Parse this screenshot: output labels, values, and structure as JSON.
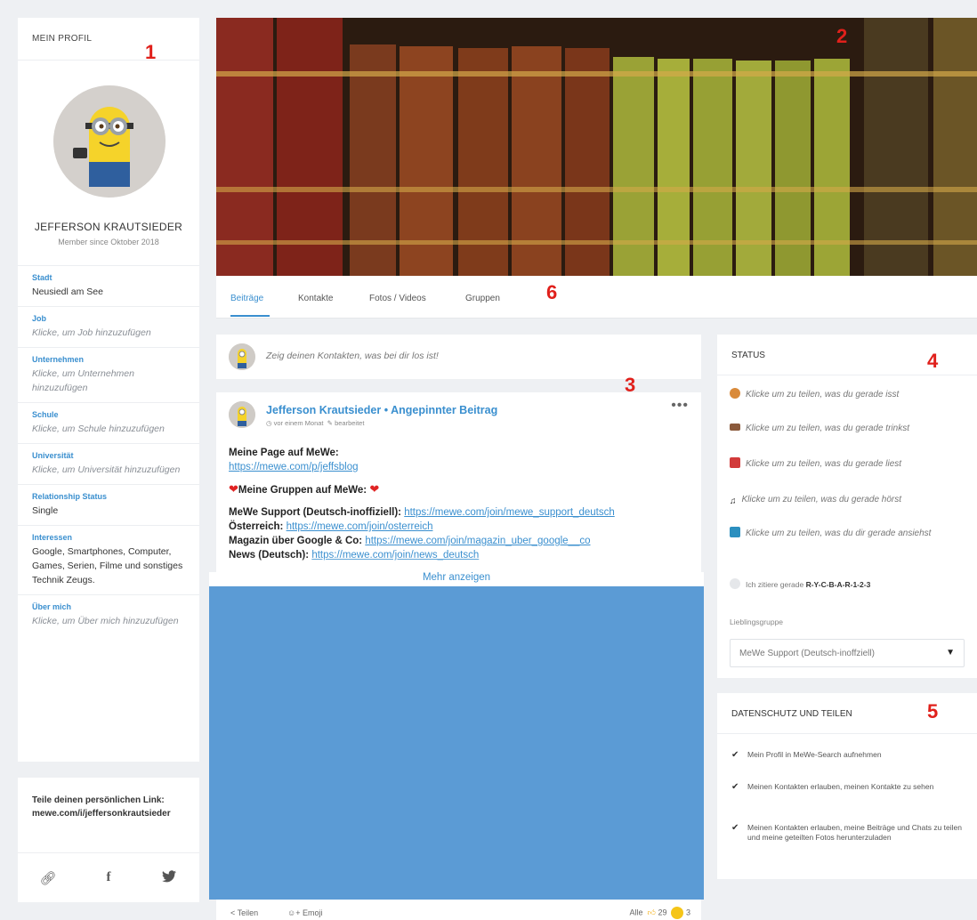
{
  "profile": {
    "header": "MEIN PROFIL",
    "name": "JEFFERSON KRAUTSIEDER",
    "member_since": "Member since Oktober 2018",
    "fields": [
      {
        "label": "Stadt",
        "value": "Neusiedl am See",
        "placeholder": false
      },
      {
        "label": "Job",
        "value": "Klicke, um Job hinzuzufügen",
        "placeholder": true
      },
      {
        "label": "Unternehmen",
        "value": "Klicke, um Unternehmen hinzuzufügen",
        "placeholder": true
      },
      {
        "label": "Schule",
        "value": "Klicke, um Schule hinzuzufügen",
        "placeholder": true
      },
      {
        "label": "Universität",
        "value": "Klicke, um Universität hinzuzufügen",
        "placeholder": true
      },
      {
        "label": "Relationship Status",
        "value": "Single",
        "placeholder": false
      },
      {
        "label": "Interessen",
        "value": "Google, Smartphones, Computer, Games, Serien, Filme und sonstiges Technik Zeugs.",
        "placeholder": false
      },
      {
        "label": "Über mich",
        "value": "Klicke, um Über mich hinzuzufügen",
        "placeholder": true
      }
    ]
  },
  "link_card": {
    "label": "Teile deinen persönlichen Link:",
    "url": "mewe.com/i/jeffersonkrautsieder",
    "icons": [
      "link-icon",
      "facebook-icon",
      "twitter-icon"
    ]
  },
  "tabs": [
    "Beiträge",
    "Kontakte",
    "Fotos / Videos",
    "Gruppen"
  ],
  "composer": {
    "placeholder": "Zeig deinen Kontakten, was bei dir los ist!"
  },
  "post": {
    "author": "Jefferson Krautsieder",
    "pinned": "Angepinnter Beitrag",
    "time": "vor einem Monat",
    "edited": "bearbeitet",
    "line1": "Meine Page auf MeWe:",
    "link1": "https://mewe.com/p/jeffsblog",
    "groups_title": "Meine Gruppen auf MeWe:",
    "g1_label": "MeWe Support (Deutsch-inoffiziell):",
    "g1_link": "https://mewe.com/join/mewe_support_deutsch",
    "g2_label": "Österreich:",
    "g2_link": "https://mewe.com/join/osterreich",
    "g3_label": "Magazin über Google & Co:",
    "g3_link": "https://mewe.com/join/magazin_uber_google__co",
    "g4_label": "News (Deutsch):",
    "g4_link": "https://mewe.com/join/news_deutsch",
    "more": "Mehr anzeigen",
    "share": "Teilen",
    "emoji": "Emoji",
    "all": "Alle",
    "like_count": "29",
    "laugh_count": "3"
  },
  "status": {
    "header": "STATUS",
    "rows": [
      "Klicke um zu teilen, was du gerade isst",
      "Klicke um zu teilen, was du gerade trinkst",
      "Klicke um zu teilen, was du gerade liest",
      "Klicke um zu teilen, was du gerade hörst",
      "Klicke um zu teilen, was du dir gerade ansiehst"
    ],
    "cite_prefix": "Ich zitiere gerade",
    "cite_value": "R-Y-C-B-A-R-1-2-3",
    "fav_label": "Lieblingsgruppe",
    "fav_value": "MeWe Support (Deutsch-inoffziell)"
  },
  "privacy": {
    "header": "DATENSCHUTZ UND TEILEN",
    "rows": [
      "Mein Profil in MeWe-Search aufnehmen",
      "Meinen Kontakten erlauben, meinen Kontakte zu sehen",
      "Meinen Kontakten erlauben, meine Beiträge und Chats zu teilen und meine geteilten Fotos herunterzuladen"
    ]
  },
  "annotations": [
    "1",
    "2",
    "3",
    "4",
    "5",
    "6"
  ],
  "colors": {
    "accent": "#3a8fcf",
    "annotation": "#e0201b",
    "media_placeholder": "#5b9bd5"
  }
}
